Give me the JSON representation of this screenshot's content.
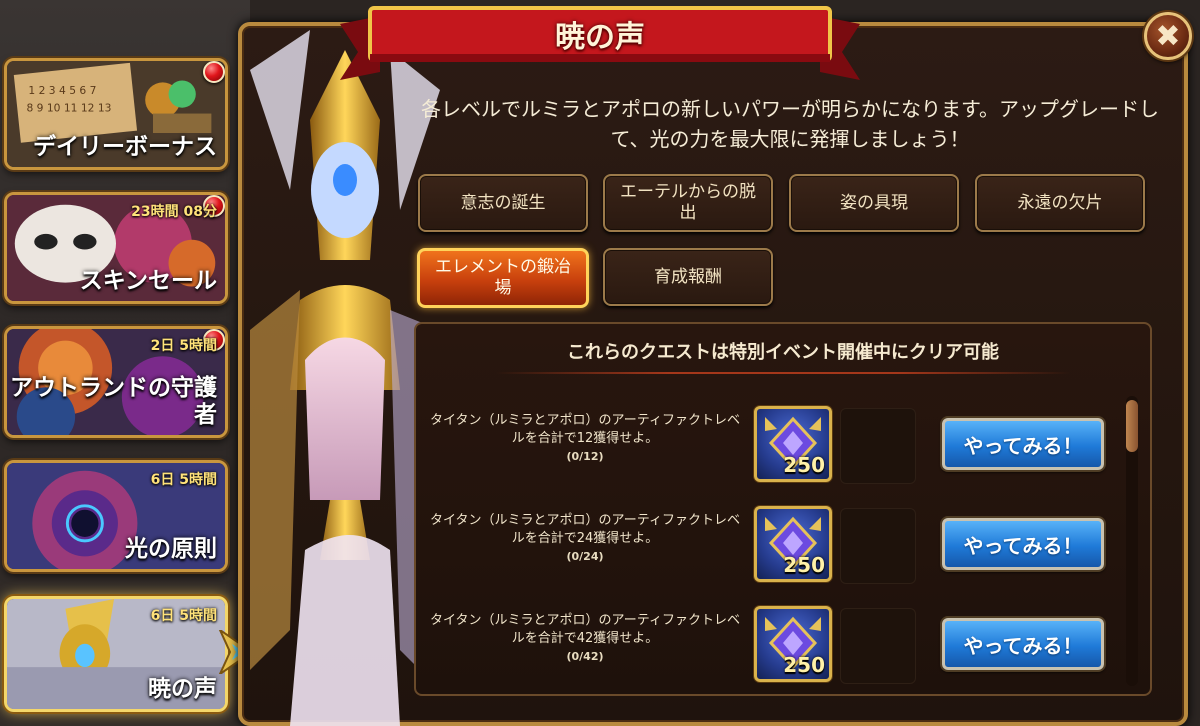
{
  "header": {
    "title": "暁の声",
    "close_icon": "close-icon"
  },
  "description": "各レベルでルミラとアポロの新しいパワーが明らかになります。アップグレードして、光の力を最大限に発揮しましょう！",
  "sidebar": {
    "items": [
      {
        "title": "デイリーボーナス",
        "timer": "",
        "badge": true,
        "active": false
      },
      {
        "title": "スキンセール",
        "timer": "23時間 08分",
        "badge": true,
        "active": false
      },
      {
        "title": "アウトランドの守護者",
        "timer": "2日 5時間",
        "badge": true,
        "active": false
      },
      {
        "title": "光の原則",
        "timer": "6日 5時間",
        "badge": false,
        "active": false
      },
      {
        "title": "暁の声",
        "timer": "6日 5時間",
        "badge": false,
        "active": true
      }
    ]
  },
  "tabs": [
    {
      "label": "意志の誕生",
      "active": false
    },
    {
      "label": "エーテルからの脱出",
      "active": false
    },
    {
      "label": "姿の具現",
      "active": false
    },
    {
      "label": "永遠の欠片",
      "active": false
    },
    {
      "label": "エレメントの鍛冶場",
      "active": true
    },
    {
      "label": "育成報酬",
      "active": false
    }
  ],
  "quests": {
    "header": "これらのクエストは特別イベント開催中にクリア可能",
    "items": [
      {
        "text": "タイタン（ルミラとアポロ）のアーティファクトレベルを合計で12獲得せよ。",
        "progress": "(0/12)",
        "reward_icon": "artifact-chest-icon",
        "reward_amount": "250",
        "button": "やってみる！"
      },
      {
        "text": "タイタン（ルミラとアポロ）のアーティファクトレベルを合計で24獲得せよ。",
        "progress": "(0/24)",
        "reward_icon": "artifact-chest-icon",
        "reward_amount": "250",
        "button": "やってみる！"
      },
      {
        "text": "タイタン（ルミラとアポロ）のアーティファクトレベルを合計で42獲得せよ。",
        "progress": "(0/42)",
        "reward_icon": "artifact-chest-icon",
        "reward_amount": "250",
        "button": "やってみる！"
      }
    ]
  },
  "colors": {
    "accent_gold": "#d9b24c",
    "ribbon_red": "#b5141a",
    "active_tab_orange": "#e0611a",
    "button_blue": "#1f7ad8"
  }
}
